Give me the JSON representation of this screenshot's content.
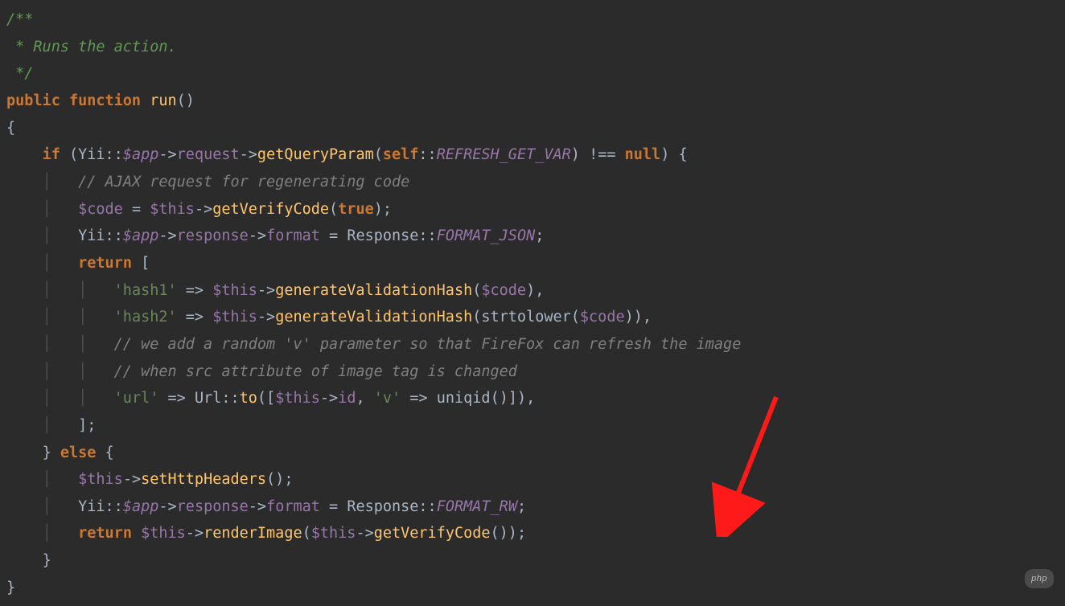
{
  "code": {
    "doc1": "/**",
    "doc2": " * Runs the action.",
    "doc3": " */",
    "kw_public": "public",
    "kw_function": "function",
    "fn_run": "run",
    "p_run": "()",
    "brace_open": "{",
    "kw_if": "if",
    "yii1": "Yii",
    "var_app": "$app",
    "prop_request": "request",
    "fn_getQueryParam": "getQueryParam",
    "kw_self": "self",
    "const_refresh": "REFRESH_GET_VAR",
    "op_neq": "!==",
    "kw_null": "null",
    "comm_ajax": "// AJAX request for regenerating code",
    "var_code": "$code",
    "var_this": "$this",
    "fn_getVerifyCode": "getVerifyCode",
    "kw_true": "true",
    "prop_response": "response",
    "prop_format": "format",
    "ty_response": "Response",
    "const_json": "FORMAT_JSON",
    "kw_return": "return",
    "str_hash1": "'hash1'",
    "fn_genHash": "generateValidationHash",
    "str_hash2": "'hash2'",
    "fn_strtolower": "strtolower",
    "comm_v1": "// we add a random 'v' parameter so that FireFox can refresh the image",
    "comm_v2": "// when src attribute of image tag is changed",
    "str_url": "'url'",
    "ty_url": "Url",
    "fn_to": "to",
    "prop_id": "id",
    "str_v": "'v'",
    "fn_uniqid": "uniqid",
    "kw_else": "else",
    "fn_setHttpHeaders": "setHttpHeaders",
    "const_raw_a": "FORMAT_R",
    "const_raw_b": "W",
    "fn_renderImage": "renderImage",
    "brace_close": "}"
  },
  "watermark": "php"
}
